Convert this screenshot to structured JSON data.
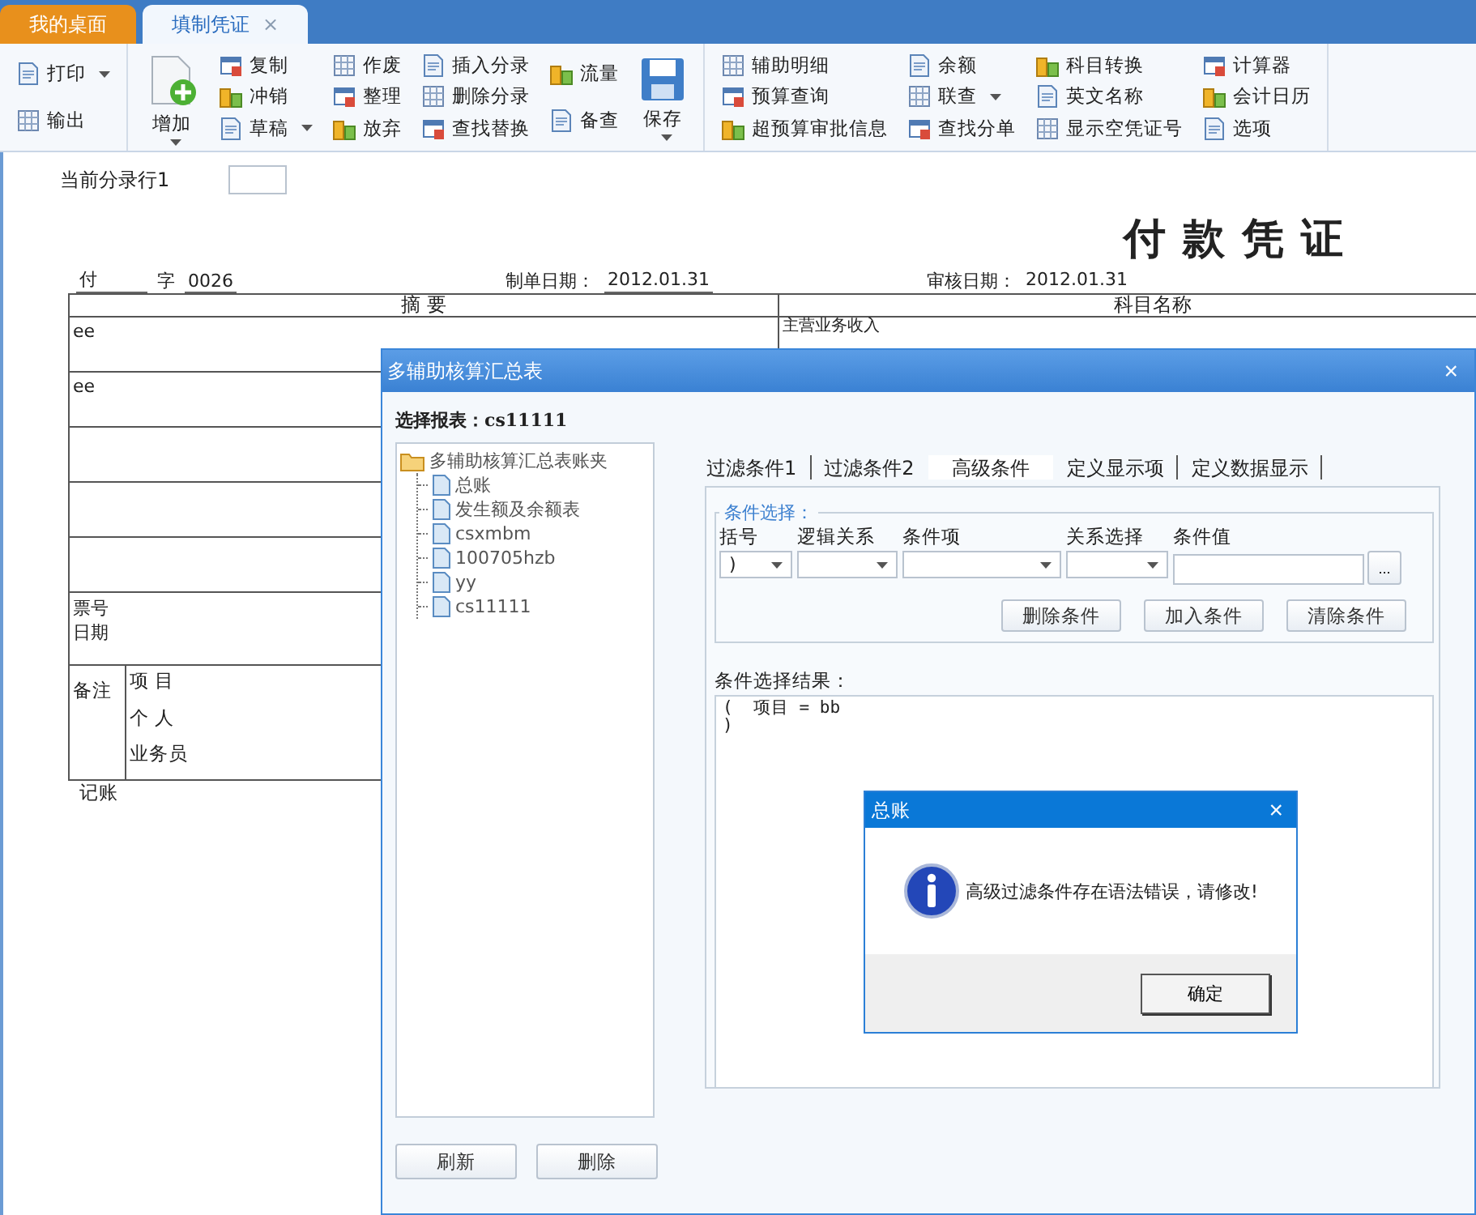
{
  "tabs": [
    {
      "label": "我的桌面",
      "selected": false
    },
    {
      "label": "填制凭证",
      "selected": true,
      "close": "×"
    }
  ],
  "toolbar": {
    "groups": [
      {
        "columns": [
          [
            {
              "label": "打印",
              "kind": "small",
              "dropdown": true
            },
            {
              "label": "输出",
              "kind": "small",
              "dropdown": false
            }
          ]
        ]
      },
      {
        "columns": [
          [
            {
              "label": "增加",
              "kind": "big",
              "dropdown": true
            }
          ],
          [
            {
              "label": "复制",
              "kind": "small",
              "dropdown": false
            },
            {
              "label": "冲销",
              "kind": "small",
              "dropdown": false
            },
            {
              "label": "草稿",
              "kind": "small",
              "dropdown": true
            }
          ],
          [
            {
              "label": "作废",
              "kind": "small",
              "dropdown": false
            },
            {
              "label": "整理",
              "kind": "small",
              "dropdown": false
            },
            {
              "label": "放弃",
              "kind": "small",
              "dropdown": false
            }
          ],
          [
            {
              "label": "插入分录",
              "kind": "small",
              "dropdown": false
            },
            {
              "label": "删除分录",
              "kind": "small",
              "dropdown": false
            },
            {
              "label": "查找替换",
              "kind": "small",
              "dropdown": false
            }
          ],
          [
            {
              "label": "流量",
              "kind": "small",
              "dropdown": false
            },
            {
              "label": "备查",
              "kind": "small",
              "dropdown": false
            }
          ],
          [
            {
              "label": "保存",
              "kind": "big",
              "dropdown": true
            }
          ]
        ]
      },
      {
        "columns": [
          [
            {
              "label": "辅助明细",
              "kind": "small",
              "dropdown": false
            },
            {
              "label": "预算查询",
              "kind": "small",
              "dropdown": false
            },
            {
              "label": "超预算审批信息",
              "kind": "small",
              "dropdown": false
            }
          ],
          [
            {
              "label": "余额",
              "kind": "small",
              "dropdown": false
            },
            {
              "label": "联查",
              "kind": "small",
              "dropdown": true
            },
            {
              "label": "查找分单",
              "kind": "small",
              "dropdown": false
            }
          ],
          [
            {
              "label": "科目转换",
              "kind": "small",
              "dropdown": false
            },
            {
              "label": "英文名称",
              "kind": "small",
              "dropdown": false
            },
            {
              "label": "显示空凭证号",
              "kind": "small",
              "dropdown": false
            }
          ],
          [
            {
              "label": "计算器",
              "kind": "small",
              "dropdown": false
            },
            {
              "label": "会计日历",
              "kind": "small",
              "dropdown": false
            },
            {
              "label": "选项",
              "kind": "small",
              "dropdown": false
            }
          ]
        ]
      }
    ]
  },
  "voucher": {
    "current_row_label": "当前分录行1",
    "title": "付 款 凭 证",
    "type": "付",
    "word_label": "字",
    "number": "0026",
    "made_date_label": "制单日期：",
    "made_date": "2012.01.31",
    "audit_date_label": "审核日期：",
    "audit_date": "2012.01.31",
    "columns": [
      "摘 要",
      "科目名称"
    ],
    "rows": [
      {
        "summary": "ee",
        "account": "主营业务收入"
      },
      {
        "summary": "ee"
      }
    ],
    "ticket_labels": [
      "票号",
      "日期"
    ],
    "remarks_label": "备注",
    "remarks_fields": [
      "项 目",
      "个 人",
      "业务员"
    ],
    "bookkeeping_label": "记账"
  },
  "dialog": {
    "title": "多辅助核算汇总表",
    "close": "×",
    "report_label": "选择报表：",
    "report_value": "cs11111",
    "tree": [
      {
        "label": "多辅助核算汇总表账夹",
        "kind": "folder",
        "children": [
          {
            "label": "总账",
            "kind": "file"
          },
          {
            "label": "发生额及余额表",
            "kind": "file"
          },
          {
            "label": "csxmbm",
            "kind": "file"
          },
          {
            "label": "100705hzb",
            "kind": "file"
          },
          {
            "label": "yy",
            "kind": "file"
          },
          {
            "label": "cs11111",
            "kind": "file"
          }
        ]
      }
    ],
    "left_buttons": [
      "刷新",
      "删除"
    ],
    "tabs": [
      {
        "label": "过滤条件1",
        "selected": false
      },
      {
        "label": "过滤条件2",
        "selected": false
      },
      {
        "label": "高级条件",
        "selected": true
      },
      {
        "label": "定义显示项",
        "selected": false
      },
      {
        "label": "定义数据显示",
        "selected": false
      }
    ],
    "condition": {
      "legend": "条件选择：",
      "fields": [
        {
          "label": "括号",
          "kind": "combo",
          "value": ")"
        },
        {
          "label": "逻辑关系",
          "kind": "combo"
        },
        {
          "label": "条件项",
          "kind": "combo"
        },
        {
          "label": "关系选择",
          "kind": "combo"
        },
        {
          "label": "条件值",
          "kind": "text",
          "button": "..."
        }
      ],
      "buttons": [
        "删除条件",
        "加入条件",
        "清除条件"
      ]
    },
    "result_label": "条件选择结果：",
    "result_lines": [
      "(  项目 = bb",
      ")"
    ]
  },
  "message": {
    "title": "总账",
    "close": "×",
    "text": "高级过滤条件存在语法错误，请修改!",
    "button": "确定"
  }
}
